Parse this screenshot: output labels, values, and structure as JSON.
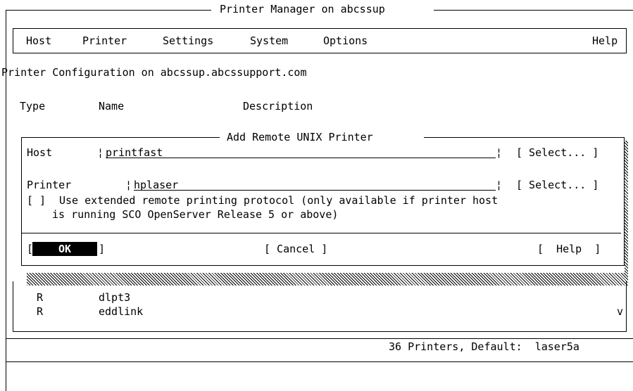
{
  "window": {
    "title": "Printer Manager on abcssup"
  },
  "menu": {
    "items": [
      "Host",
      "Printer",
      "Settings",
      "System",
      "Options"
    ],
    "help": "Help"
  },
  "config_title": "Printer Configuration on abcssup.abcssupport.com",
  "columns": {
    "type": "Type",
    "name": "Name",
    "description": "Description"
  },
  "dialog": {
    "title": "Add Remote UNIX Printer",
    "host_label": "Host",
    "host_value": "printfast",
    "printer_label": "Printer",
    "printer_value": "hplaser",
    "select_label": "[ Select... ]",
    "checkbox_mark": "[ ]",
    "checkbox_line1": "Use extended remote printing protocol (only available if printer host",
    "checkbox_line2": "is running SCO OpenServer Release 5 or above)",
    "ok": "OK",
    "cancel": "[ Cancel ]",
    "help": "[  Help  ]"
  },
  "printers": [
    {
      "type": "R",
      "name": "dlpt3"
    },
    {
      "type": "R",
      "name": "eddlink"
    }
  ],
  "scroll_indicator": "v",
  "status": "36 Printers, Default:  laser5a"
}
